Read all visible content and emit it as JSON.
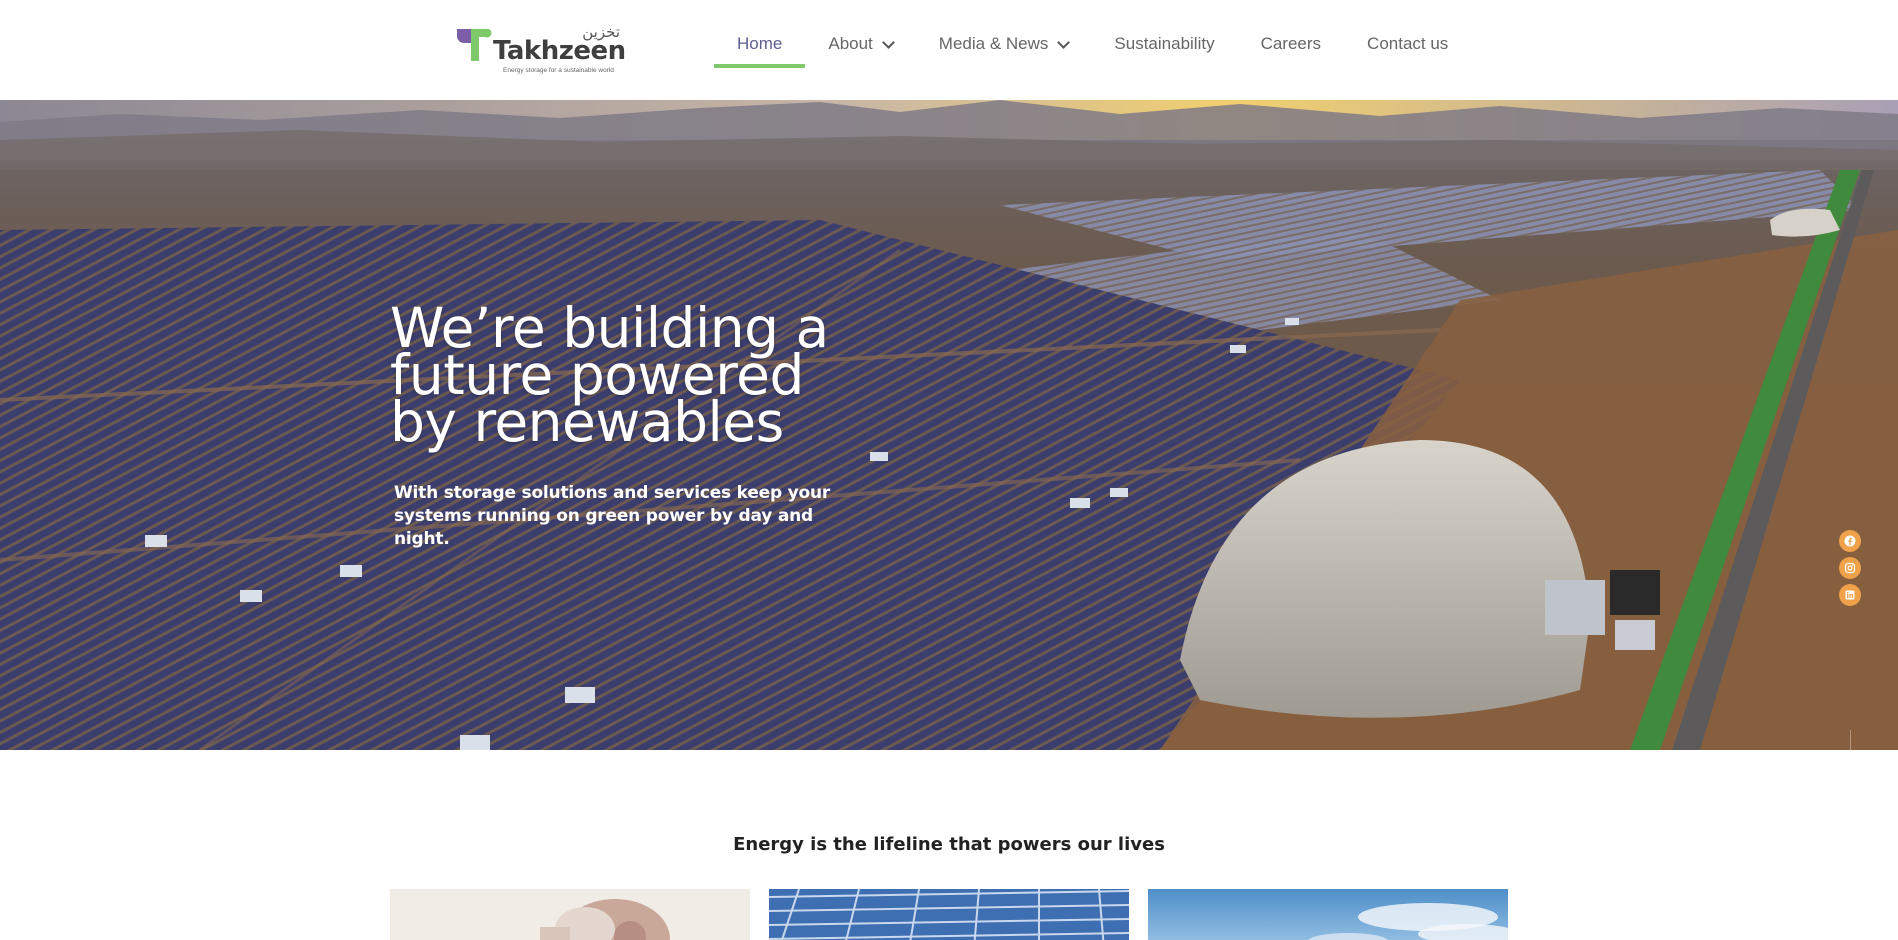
{
  "brand": {
    "name": "Takhzeen",
    "arabic": "تخزين",
    "tagline": "Energy storage for a sustainable world"
  },
  "nav": {
    "items": [
      {
        "label": "Home",
        "active": true,
        "dropdown": false
      },
      {
        "label": "About",
        "active": false,
        "dropdown": true
      },
      {
        "label": "Media & News",
        "active": false,
        "dropdown": true
      },
      {
        "label": "Sustainability",
        "active": false,
        "dropdown": false
      },
      {
        "label": "Careers",
        "active": false,
        "dropdown": false
      },
      {
        "label": "Contact us",
        "active": false,
        "dropdown": false
      }
    ]
  },
  "hero": {
    "title_line1": "We’re building a",
    "title_line2": "future powered",
    "title_line3": "by renewables",
    "subtitle_line1": "With storage solutions and services keep your",
    "subtitle_line2": "systems running on green power by day and night."
  },
  "social": [
    "facebook-icon",
    "instagram-icon",
    "linkedin-icon"
  ],
  "section": {
    "tagline": "Energy is the lifeline that powers our lives"
  },
  "colors": {
    "accent_green": "#7ec96a",
    "accent_purple": "#7b5ea7",
    "nav_active": "#5c5f8f",
    "social_orange": "#f0a24a"
  }
}
